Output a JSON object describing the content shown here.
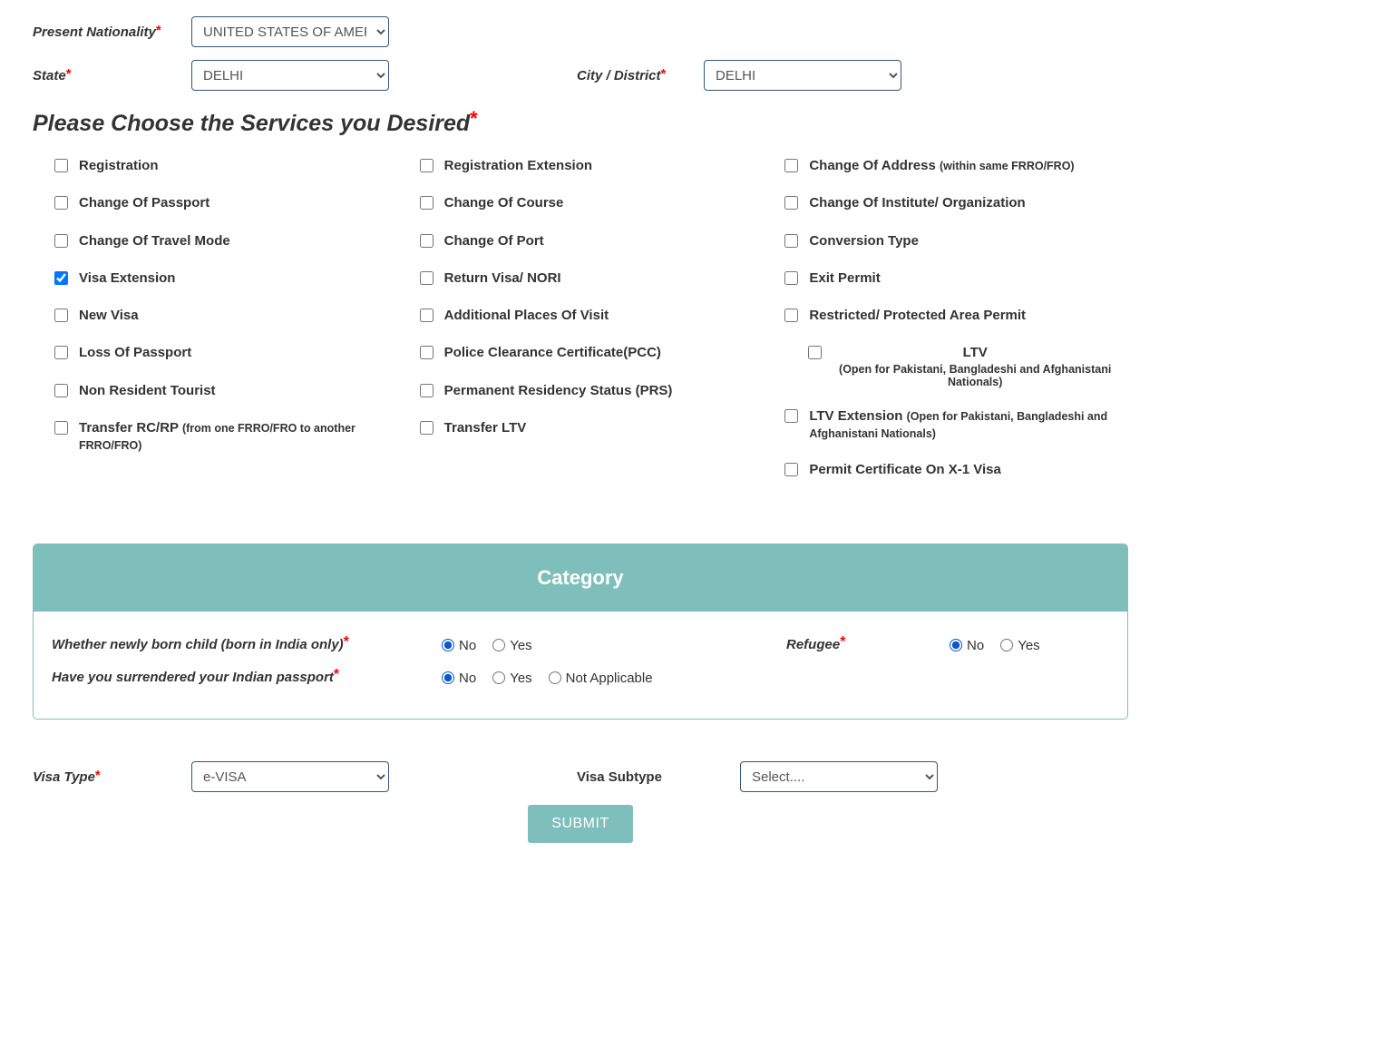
{
  "top": {
    "nationality_label": "Present Nationality",
    "nationality_value": "UNITED STATES OF AMERICA",
    "state_label": "State",
    "state_value": "DELHI",
    "city_label": "City / District",
    "city_value": "DELHI"
  },
  "services_heading": "Please Choose the Services you Desired",
  "services": {
    "col1": [
      {
        "label": "Registration",
        "checked": false
      },
      {
        "label": "Change Of Passport",
        "checked": false
      },
      {
        "label": "Change Of Travel Mode",
        "checked": false
      },
      {
        "label": "Visa Extension",
        "checked": true
      },
      {
        "label": "New Visa",
        "checked": false
      },
      {
        "label": "Loss Of Passport",
        "checked": false
      },
      {
        "label": "Non Resident Tourist",
        "checked": false
      },
      {
        "label": "Transfer RC/RP ",
        "note": "(from one FRRO/FRO to another FRRO/FRO)",
        "checked": false
      }
    ],
    "col2": [
      {
        "label": "Registration Extension",
        "checked": false
      },
      {
        "label": "Change Of Course",
        "checked": false
      },
      {
        "label": "Change Of Port",
        "checked": false
      },
      {
        "label": "Return Visa/ NORI",
        "checked": false
      },
      {
        "label": "Additional Places Of Visit",
        "checked": false
      },
      {
        "label": "Police Clearance Certificate(PCC)",
        "checked": false
      },
      {
        "label": "Permanent Residency Status (PRS)",
        "checked": false
      },
      {
        "label": "Transfer LTV",
        "checked": false
      }
    ],
    "col3": [
      {
        "label": "Change Of Address ",
        "note": "(within same FRRO/FRO)",
        "checked": false
      },
      {
        "label": "Change Of Institute/ Organization",
        "checked": false
      },
      {
        "label": "Conversion Type",
        "checked": false
      },
      {
        "label": "Exit Permit",
        "checked": false
      },
      {
        "label": "Restricted/ Protected Area Permit",
        "checked": false
      },
      {
        "label": "LTV ",
        "note": "(Open for Pakistani, Bangladeshi and Afghanistani Nationals)",
        "checked": false,
        "indented": true
      },
      {
        "label": "LTV Extension ",
        "note": "(Open for Pakistani, Bangladeshi and Afghanistani Nationals)",
        "checked": false
      },
      {
        "label": "Permit Certificate On X-1 Visa",
        "checked": false
      }
    ]
  },
  "category": {
    "header": "Category",
    "q1": "Whether newly born child  (born in India only)",
    "q2": "Refugee",
    "q3": "Have you surrendered your Indian passport",
    "opts": {
      "no": "No",
      "yes": "Yes",
      "na": "Not Applicable"
    }
  },
  "bottom": {
    "visa_type_label": "Visa Type",
    "visa_type_value": "e-VISA",
    "visa_subtype_label": "Visa Subtype",
    "visa_subtype_value": "Select....",
    "submit_label": "SUBMIT"
  }
}
